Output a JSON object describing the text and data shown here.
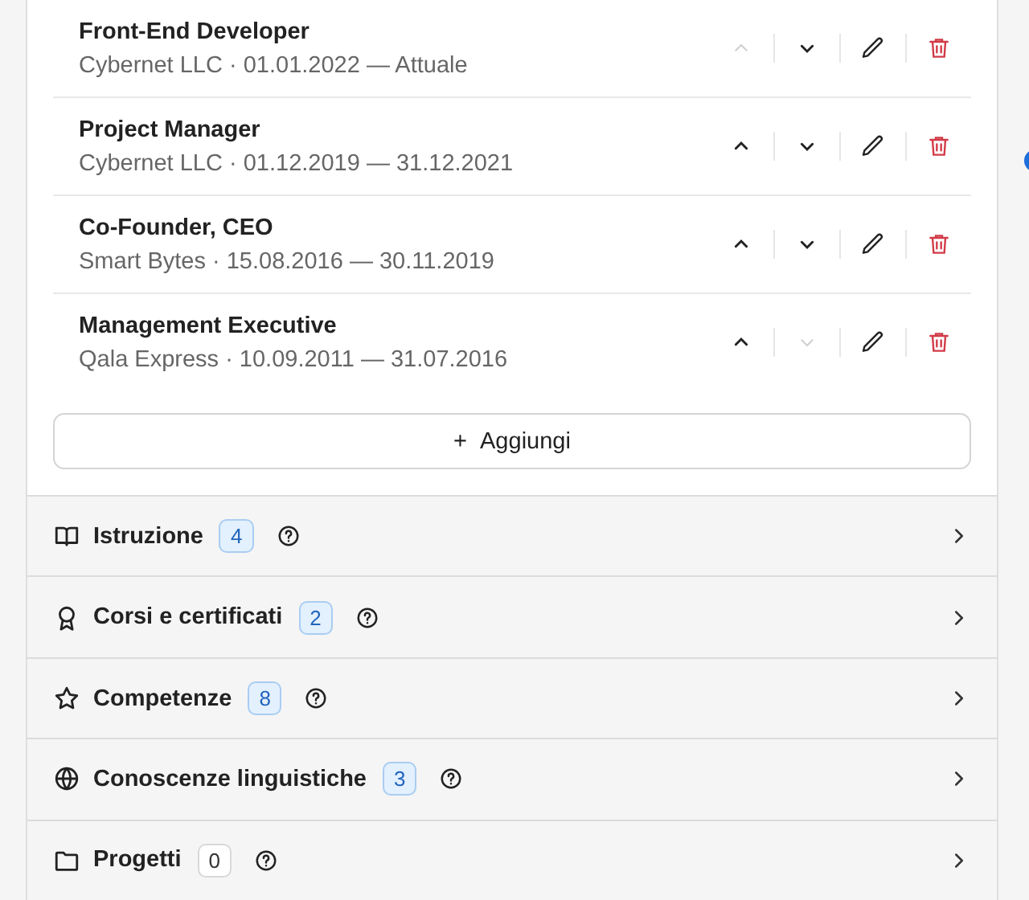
{
  "experience": [
    {
      "title": "Front-End Developer",
      "subtitle": "Cybernet LLC · 01.01.2022 — Attuale",
      "up_disabled": true,
      "down_disabled": false
    },
    {
      "title": "Project Manager",
      "subtitle": "Cybernet LLC · 01.12.2019 — 31.12.2021",
      "up_disabled": false,
      "down_disabled": false
    },
    {
      "title": "Co-Founder, CEO",
      "subtitle": "Smart Bytes · 15.08.2016 — 30.11.2019",
      "up_disabled": false,
      "down_disabled": false
    },
    {
      "title": "Management Executive",
      "subtitle": "Qala Express · 10.09.2011 — 31.07.2016",
      "up_disabled": false,
      "down_disabled": true
    }
  ],
  "add_button": {
    "icon": "+",
    "label": "Aggiungi"
  },
  "sections": [
    {
      "kind": "book",
      "title": "Istruzione",
      "count": "4",
      "highlighted": true
    },
    {
      "kind": "award",
      "title": "Corsi e certificati",
      "count": "2",
      "highlighted": true
    },
    {
      "kind": "star",
      "title": "Competenze",
      "count": "8",
      "highlighted": true
    },
    {
      "kind": "globe",
      "title": "Conoscenze linguistiche",
      "count": "3",
      "highlighted": true
    },
    {
      "kind": "folder",
      "title": "Progetti",
      "count": "0",
      "highlighted": false
    }
  ]
}
